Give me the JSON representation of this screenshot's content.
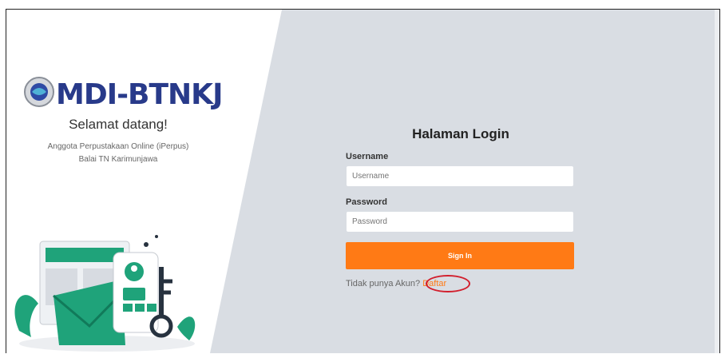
{
  "logo": {
    "text": "MDI-BTNKJ"
  },
  "welcome": {
    "title": "Selamat datang!",
    "subtitle_line1": "Anggota Perpustakaan Online (iPerpus)",
    "subtitle_line2": "Balai TN Karimunjawa"
  },
  "login": {
    "title": "Halaman Login",
    "username_label": "Username",
    "username_placeholder": "Username",
    "password_label": "Password",
    "password_placeholder": "Password",
    "signin_label": "Sign In",
    "no_account_text": "Tidak punya Akun?",
    "register_link": "Daftar"
  },
  "colors": {
    "accent": "#ff7a15",
    "panel_bg": "#d9dde3",
    "illustration_green": "#1fa37a",
    "highlight_red": "#d21f2d",
    "logo_blue": "#283a8a"
  },
  "icons": {
    "logo_emblem": "seal-emblem",
    "illustration": "login-security-illustration"
  }
}
